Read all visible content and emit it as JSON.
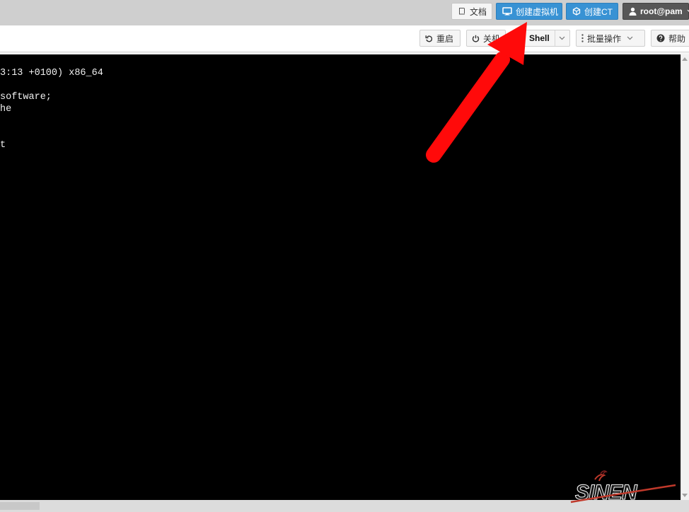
{
  "header": {
    "docs_label": "文档",
    "create_vm_label": "创建虚拟机",
    "create_ct_label": "创建CT",
    "user_label": "root@pam"
  },
  "toolbar": {
    "restart_label": "重启",
    "shutdown_label": "关机",
    "shell_label": "Shell",
    "bulk_label": "批量操作",
    "help_label": "帮助"
  },
  "terminal": {
    "lines": [
      "3:13 +0100) x86_64",
      "software;",
      "he",
      "t"
    ]
  },
  "watermark": {
    "text": "SINEN"
  },
  "colors": {
    "primary_button": "#3892d4",
    "user_button": "#575757",
    "terminal_bg": "#000000",
    "arrow": "#ff0a0a"
  },
  "icons": {
    "docs": "book-icon",
    "create_vm": "monitor-icon",
    "create_ct": "cube-icon",
    "user": "user-icon",
    "restart": "undo-icon",
    "shutdown": "power-icon",
    "bulk": "vertical-ellipsis-icon",
    "help": "question-circle-icon",
    "dropdown": "chevron-down-icon"
  }
}
